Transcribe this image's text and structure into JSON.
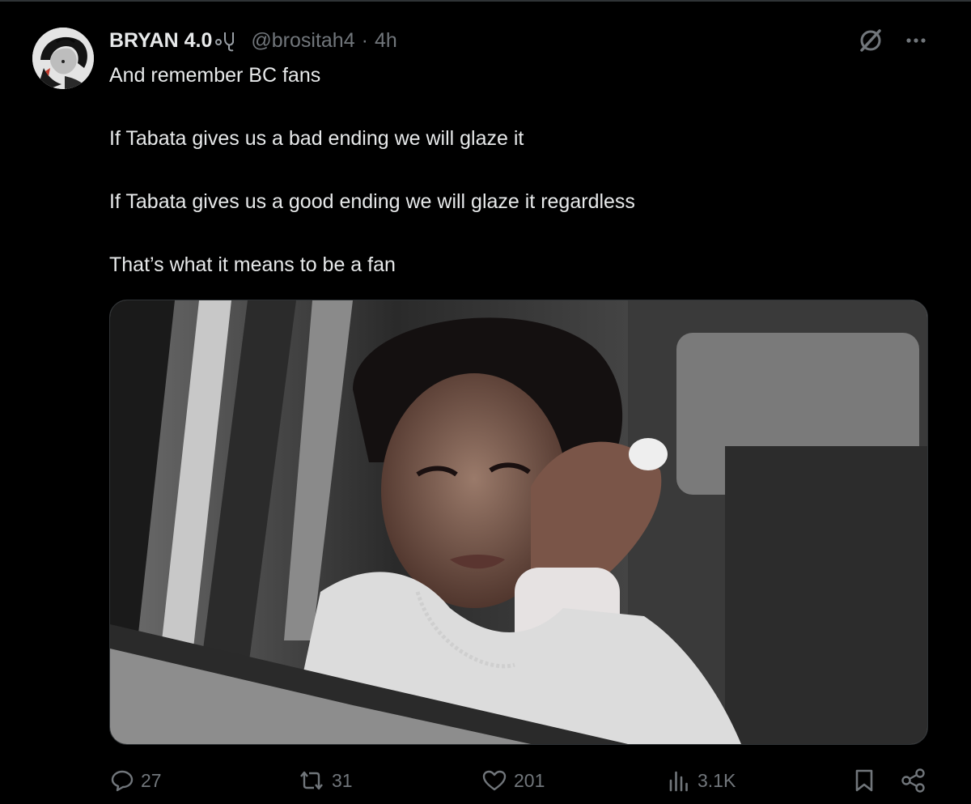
{
  "post": {
    "display_name": "BRYAN 4.0",
    "handle": "@brositah4",
    "separator": "·",
    "timestamp": "4h",
    "text_lines": [
      "And remember BC fans",
      "If Tabata gives us a bad ending we will glaze it",
      "If Tabata gives us a good ending we will glaze it regardless",
      "That’s what it means to be a fan"
    ],
    "media_alt": "photo"
  },
  "actions": {
    "replies": "27",
    "reposts": "31",
    "likes": "201",
    "views": "3.1K"
  },
  "icons": {
    "name_badge": "stethoscope-emoji-icon",
    "grok": "grok-icon",
    "more": "more-icon",
    "reply": "reply-icon",
    "repost": "repost-icon",
    "like": "heart-icon",
    "views": "views-icon",
    "bookmark": "bookmark-icon",
    "share": "share-icon"
  },
  "colors": {
    "background": "#000000",
    "text_primary": "#e7e9ea",
    "text_secondary": "#71767b",
    "border": "#2f3336"
  }
}
